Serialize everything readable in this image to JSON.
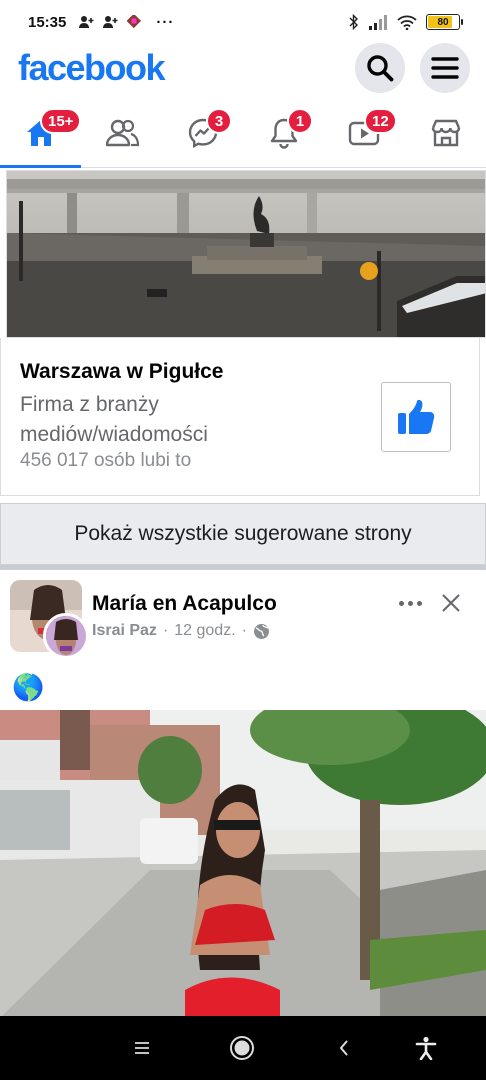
{
  "status_bar": {
    "time": "15:35",
    "more": "···",
    "battery": "80",
    "battery_level": 0.8,
    "icons": [
      "person-add-icon",
      "person-add-icon",
      "app-notification-icon",
      "bluetooth-icon",
      "signal-icon",
      "wifi-icon",
      "battery-icon"
    ]
  },
  "header": {
    "logo": "facebook",
    "icons": [
      "search-icon",
      "menu-icon"
    ]
  },
  "tabs": [
    {
      "name": "home",
      "icon": "home-icon",
      "badge": "15+",
      "active": true
    },
    {
      "name": "friends",
      "icon": "friends-icon",
      "badge": ""
    },
    {
      "name": "messenger",
      "icon": "messenger-icon",
      "badge": "3"
    },
    {
      "name": "notifications",
      "icon": "bell-icon",
      "badge": "1"
    },
    {
      "name": "watch",
      "icon": "video-icon",
      "badge": "12"
    },
    {
      "name": "marketplace",
      "icon": "store-icon",
      "badge": ""
    }
  ],
  "colors": {
    "brand": "#1877f2",
    "badge": "#e41e3f",
    "secondary_text": "#65676b"
  },
  "suggested_page": {
    "name": "Warszawa w Pigułce",
    "category": "Firma z branży mediów/wiadomości",
    "likes": "456 017 osób lubi to",
    "like_icon": "thumbs-up-icon"
  },
  "show_all_label": "Pokaż wszystkie sugerowane strony",
  "post": {
    "page": "María en Acapulco",
    "author": "Israi Paz",
    "sep": "·",
    "time": "12 godz.",
    "privacy_icon": "globe-icon",
    "text": "🌎",
    "icons": [
      "more-icon",
      "close-icon"
    ]
  },
  "nav_bar": {
    "icons": [
      "recents-icon",
      "home-circle-icon",
      "back-icon",
      "accessibility-icon"
    ]
  }
}
